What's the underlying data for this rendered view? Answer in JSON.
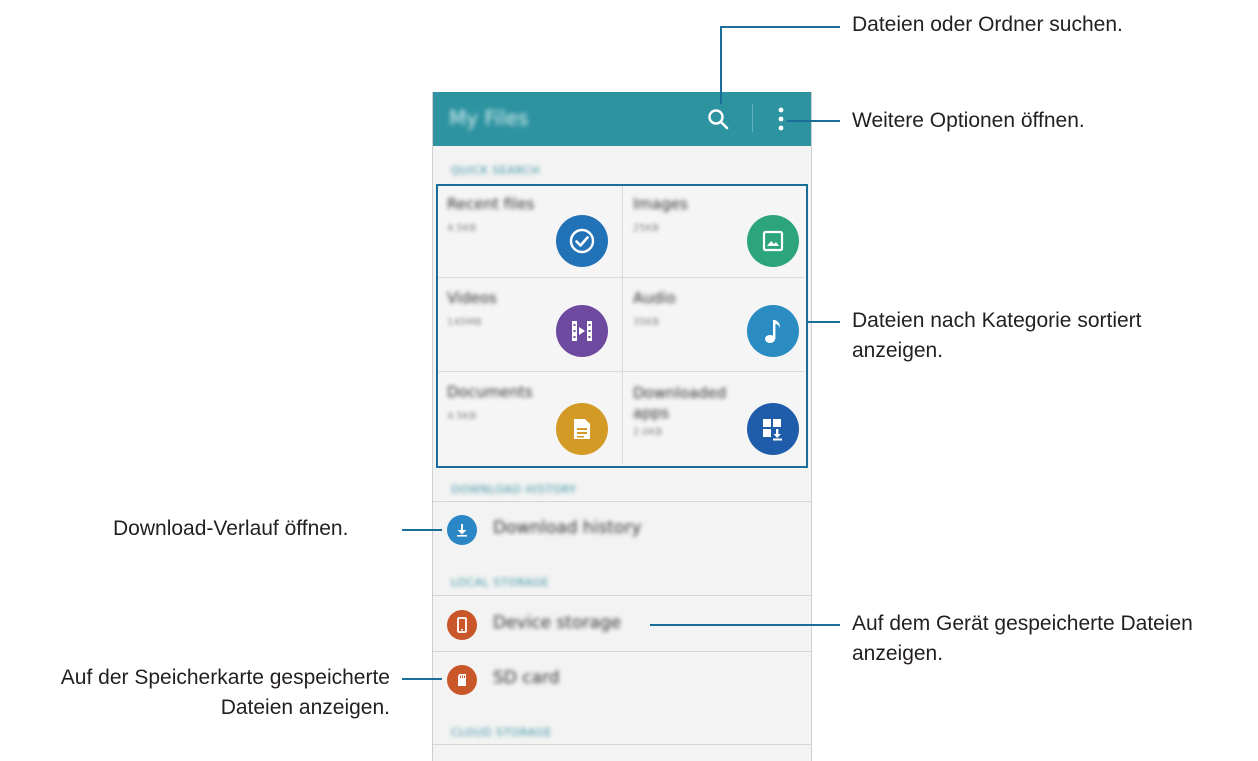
{
  "app": {
    "title": "My Files",
    "icons": {
      "search": "search-icon",
      "more": "more-options-icon"
    }
  },
  "sections": {
    "quick_search": "QUICK SEARCH",
    "download_history": "DOWNLOAD HISTORY",
    "local_storage": "LOCAL STORAGE",
    "cloud_storage": "CLOUD STORAGE"
  },
  "categories": [
    {
      "title": "Recent files",
      "sub": "4.5KB",
      "icon": "check-clock-icon",
      "color": "#2272b8"
    },
    {
      "title": "Images",
      "sub": "25KB",
      "icon": "image-icon",
      "color": "#2da57c"
    },
    {
      "title": "Videos",
      "sub": "145MB",
      "icon": "film-icon",
      "color": "#6d4aa0"
    },
    {
      "title": "Audio",
      "sub": "35KB",
      "icon": "music-note-icon",
      "color": "#2b8cc4"
    },
    {
      "title": "Documents",
      "sub": "4.5KB",
      "icon": "document-icon",
      "color": "#d39a25"
    },
    {
      "title": "Downloaded apps",
      "sub": "2.0KB",
      "icon": "download-apps-icon",
      "color": "#1f5caa"
    }
  ],
  "list": {
    "download_history": {
      "label": "Download history",
      "icon": "download-icon",
      "color": "#2b86c6"
    },
    "device_storage": {
      "label": "Device storage",
      "icon": "phone-icon",
      "color": "#c9572a"
    },
    "sd_card": {
      "label": "SD card",
      "icon": "sd-card-icon",
      "color": "#c9572a"
    }
  },
  "callouts": {
    "search": "Dateien oder Ordner suchen.",
    "more": "Weitere Optionen öffnen.",
    "categories_line1": "Dateien nach Kategorie sortiert",
    "categories_line2": "anzeigen.",
    "download_history": "Download-Verlauf öffnen.",
    "device_line1": "Auf dem Gerät gespeicherte Dateien",
    "device_line2": "anzeigen.",
    "sd_line1": "Auf der Speicherkarte gespeicherte",
    "sd_line2": "Dateien anzeigen."
  },
  "colors": {
    "accent": "#1a6f9a",
    "appbar": "#2d93a0"
  }
}
